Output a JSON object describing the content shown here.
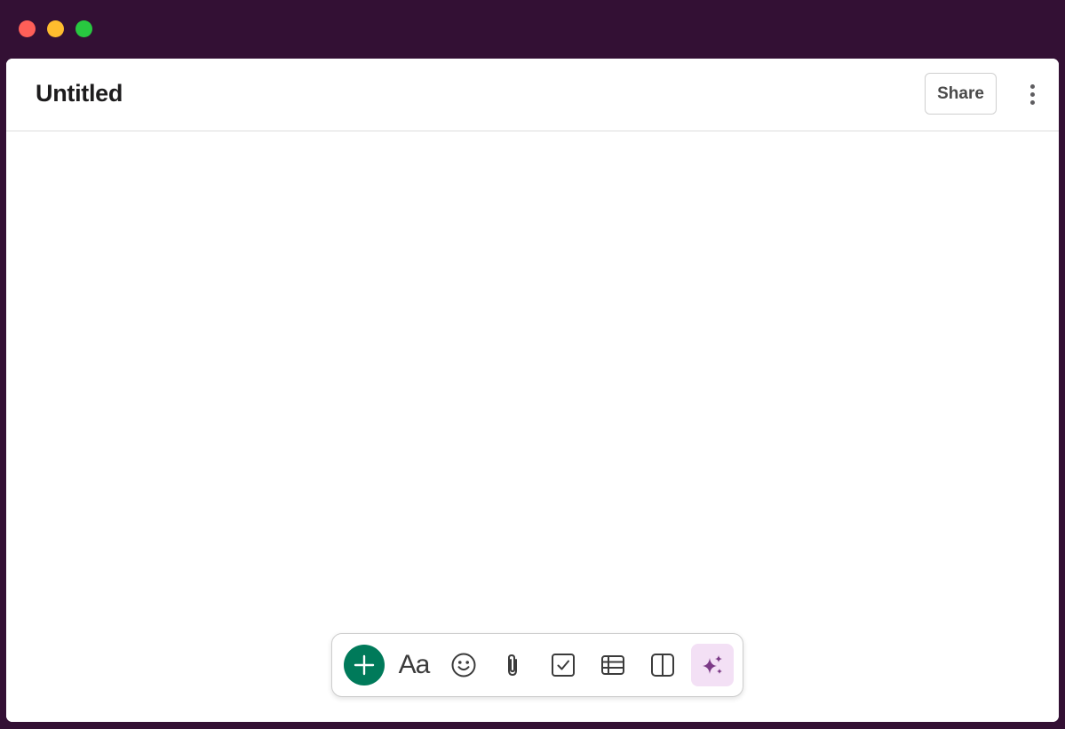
{
  "window": {
    "controls": [
      "close",
      "minimize",
      "zoom"
    ]
  },
  "header": {
    "title": "Untitled",
    "share_label": "Share",
    "more_icon": "vertical-ellipsis-icon"
  },
  "toolbar": {
    "items": [
      {
        "name": "add",
        "icon": "plus-icon"
      },
      {
        "name": "text-format",
        "label": "Aa"
      },
      {
        "name": "emoji",
        "icon": "smiley-icon"
      },
      {
        "name": "attach",
        "icon": "paperclip-icon"
      },
      {
        "name": "checklist",
        "icon": "checkbox-icon"
      },
      {
        "name": "table",
        "icon": "table-icon"
      },
      {
        "name": "columns",
        "icon": "columns-icon"
      },
      {
        "name": "ai",
        "icon": "sparkle-icon"
      }
    ]
  },
  "colors": {
    "frame": "#331034",
    "add_button": "#007a5a",
    "ai_button_bg": "#f3e0f5",
    "ai_icon": "#7c3a87"
  }
}
